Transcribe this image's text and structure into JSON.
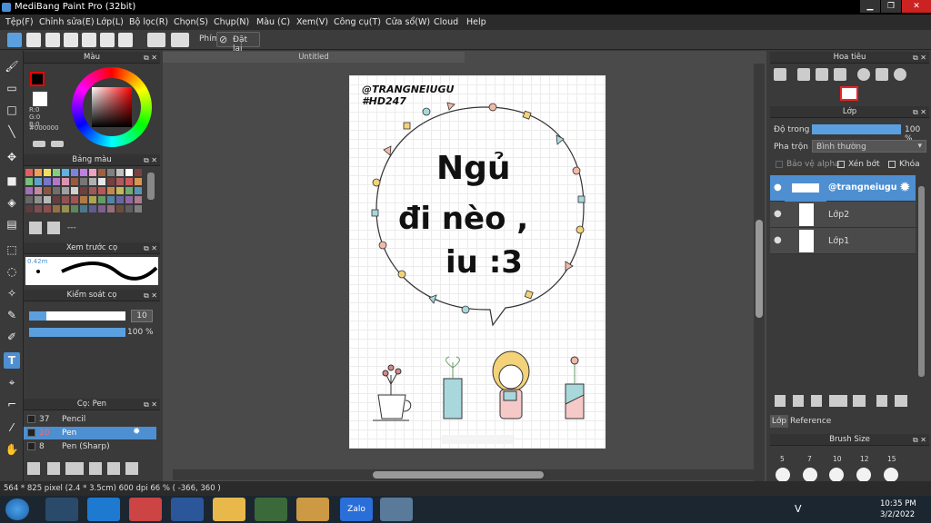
{
  "window": {
    "title": "MediBang Paint Pro (32bit)"
  },
  "menu": [
    "Tệp(F)",
    "Chỉnh sửa(E)",
    "Lớp(L)",
    "Bộ lọc(R)",
    "Chọn(S)",
    "Chụp(N)",
    "Màu (C)",
    "Xem(V)",
    "Công cụ(T)",
    "Cửa sổ(W)",
    "Cloud",
    "Help"
  ],
  "toolbar": {
    "shortcut_label": "Phím",
    "reset_label": "Đặt lại"
  },
  "color_panel": {
    "title": "Màu",
    "r": "R:0",
    "g": "G:0",
    "b": "B:0",
    "hex": "#000000"
  },
  "palette_panel": {
    "title": "Bảng màu",
    "dash": "---"
  },
  "preview_panel": {
    "title": "Xem trước cọ",
    "size": "0.42m"
  },
  "control_panel": {
    "title": "Kiểm soát cọ",
    "size_value": "10",
    "opacity_value": "100 %"
  },
  "brush_panel": {
    "title": "Cọ: Pen",
    "items": [
      {
        "size": "37",
        "name": "Pencil"
      },
      {
        "size": "10",
        "name": "Pen"
      },
      {
        "size": "8",
        "name": "Pen (Sharp)"
      }
    ]
  },
  "canvas": {
    "tab_title": "Untitled",
    "handle_line1": "@TRANGNEIUGU",
    "handle_line2": "#HD247",
    "text_line1": "Ngủ",
    "text_line2": "đi nèo ,",
    "text_line3": "iu :3"
  },
  "navigator": {
    "title": "Hoa tiêu"
  },
  "layer_panel": {
    "title": "Lớp",
    "opacity_label": "Độ trong",
    "opacity_value": "100 %",
    "blend_label": "Pha trộn",
    "blend_value": "Bình thường",
    "protect_alpha": "Bảo vệ alpha",
    "clipping": "Xén bớt",
    "lock": "Khóa",
    "layers": [
      "@trangneiugu",
      "Lớp2",
      "Lớp1"
    ],
    "tabs": [
      "Lớp",
      "Reference"
    ]
  },
  "brush_size_panel": {
    "title": "Brush Size",
    "sizes": [
      "5",
      "7",
      "10",
      "12",
      "15"
    ]
  },
  "status": {
    "text": "564 * 825 pixel  (2.4 * 3.5cm)  600 dpi  66 %  ( -366, 360 )"
  },
  "taskbar": {
    "time": "10:35 PM",
    "date": "3/2/2022",
    "zalo": "Zalo",
    "lang": "V"
  },
  "colors": {
    "accent": "#4d8fd1",
    "panel": "#3a3a3a",
    "canvas_bg": "#4a4a4a"
  }
}
